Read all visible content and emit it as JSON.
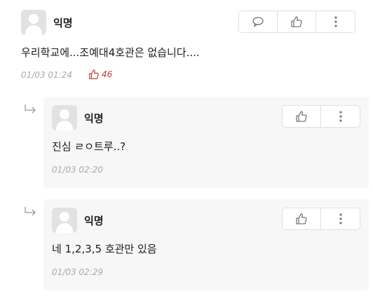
{
  "post": {
    "author": "익명",
    "content": "우리학교에...조예대4호관은 없습니다....",
    "timestamp": "01/03 01:24",
    "vote_count": "46",
    "icons": [
      "comment-icon",
      "thumbs-up-icon",
      "more-icon"
    ]
  },
  "replies": [
    {
      "author": "익명",
      "content": "진심 ㄹㅇ트루..?",
      "timestamp": "01/03 02:20",
      "icons": [
        "thumbs-up-icon",
        "more-icon"
      ]
    },
    {
      "author": "익명",
      "content": "네 1,2,3,5 호관만 있음",
      "timestamp": "01/03 02:29",
      "icons": [
        "thumbs-up-icon",
        "more-icon"
      ]
    }
  ],
  "colors": {
    "vote": "#c0392b",
    "meta": "#a9a9a9",
    "reply_bg": "#f7f7f7",
    "avatar_bg": "#e2e2e2"
  }
}
